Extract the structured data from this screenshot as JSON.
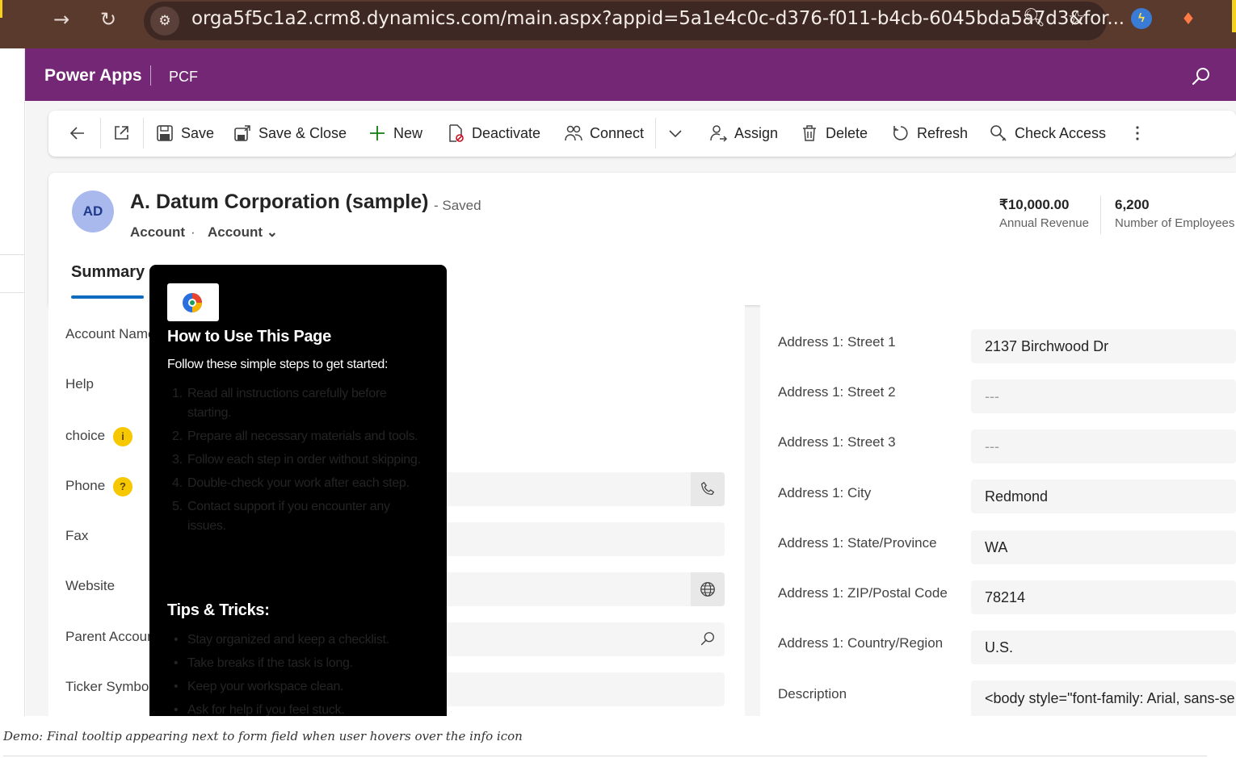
{
  "browser": {
    "url": "orga5f5c1a2.crm8.dynamics.com/main.aspx?appid=5a1e4c0c-d376-f011-b4cb-6045bda5a7d3&for..."
  },
  "app": {
    "title": "Power Apps",
    "name": "PCF"
  },
  "commands": {
    "save": "Save",
    "save_close": "Save & Close",
    "new": "New",
    "deactivate": "Deactivate",
    "connect": "Connect",
    "assign": "Assign",
    "delete": "Delete",
    "refresh": "Refresh",
    "check_access": "Check Access"
  },
  "record": {
    "initials": "AD",
    "title": "A. Datum Corporation (sample)",
    "status": "- Saved",
    "entity": "Account",
    "dot": "·",
    "form": "Account ⌄",
    "kpis": [
      {
        "value": "₹10,000.00",
        "label": "Annual Revenue"
      },
      {
        "value": "6,200",
        "label": "Number of Employees"
      }
    ],
    "tab": "Summary"
  },
  "left_fields": [
    {
      "label": "Account Name"
    },
    {
      "label": "Help"
    },
    {
      "label": "choice",
      "badge": "i"
    },
    {
      "label": "Phone",
      "badge": "?"
    },
    {
      "label": "Fax"
    },
    {
      "label": "Website"
    },
    {
      "label": "Parent Account"
    },
    {
      "label": "Ticker Symbol"
    }
  ],
  "right_fields": [
    {
      "label": "Address 1: Street 1",
      "value": "2137 Birchwood Dr"
    },
    {
      "label": "Address 1: Street 2",
      "value": "---"
    },
    {
      "label": "Address 1: Street 3",
      "value": "---"
    },
    {
      "label": "Address 1: City",
      "value": "Redmond"
    },
    {
      "label": "Address 1: State/Province",
      "value": "WA"
    },
    {
      "label": "Address 1: ZIP/Postal Code",
      "value": "78214"
    },
    {
      "label": "Address 1: Country/Region",
      "value": "U.S."
    },
    {
      "label": "Description",
      "value": "<body style=\"font-family: Arial, sans-se"
    }
  ],
  "tooltip": {
    "title": "How to Use This Page",
    "intro": "Follow these simple steps to get started:",
    "steps": [
      "Read all instructions carefully before starting.",
      "Prepare all necessary materials and tools.",
      "Follow each step in order without skipping.",
      "Double-check your work after each step.",
      "Contact support if you encounter any issues."
    ],
    "tips_title": "Tips & Tricks:",
    "tips": [
      "Stay organized and keep a checklist.",
      "Take breaks if the task is long.",
      "Keep your workspace clean.",
      "Ask for help if you feel stuck."
    ]
  },
  "caption": "Demo: Final tooltip appearing next to form field when user hovers over the info icon"
}
